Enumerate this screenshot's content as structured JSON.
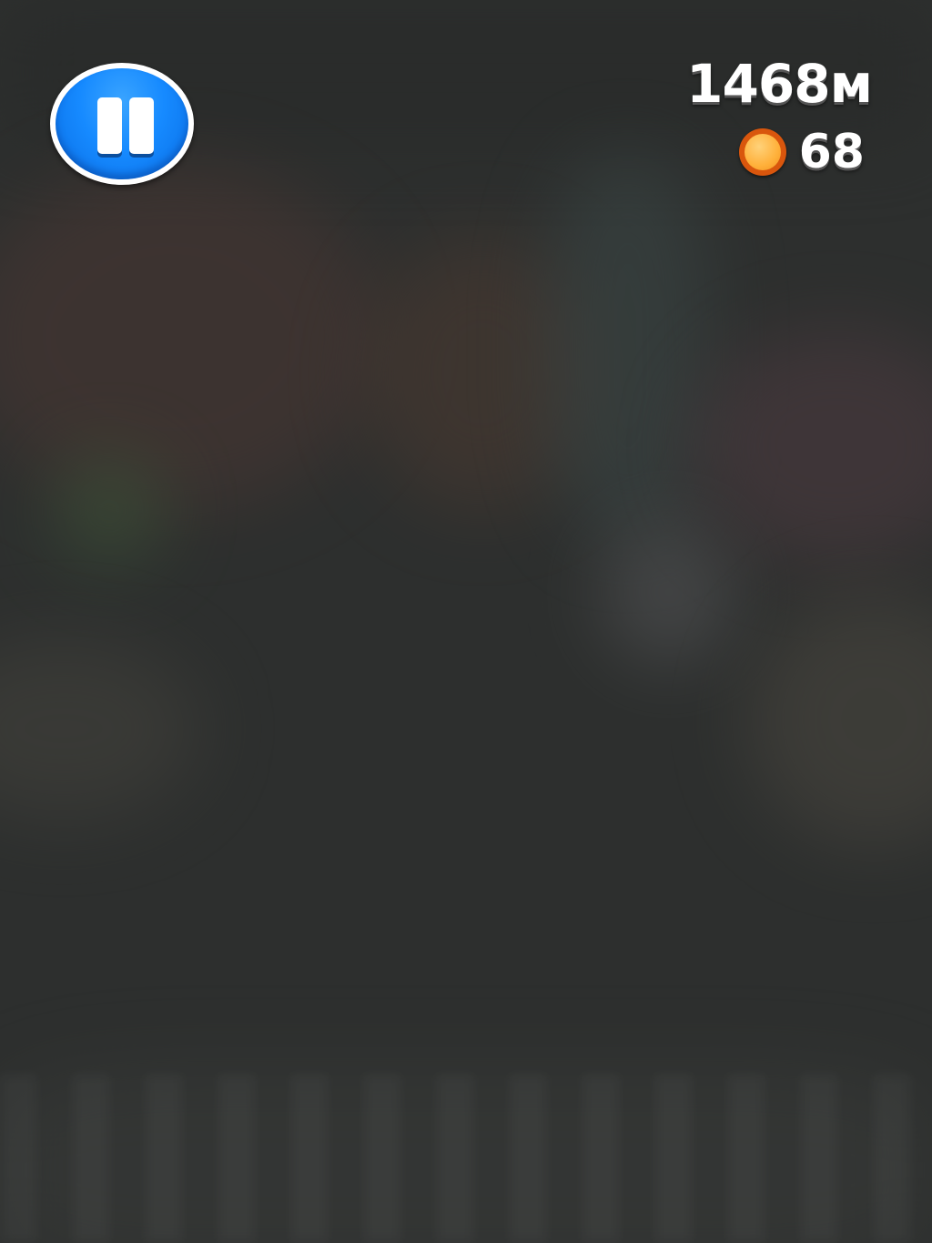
{
  "hud": {
    "distance": "1468м",
    "coins": "68"
  },
  "icons": {
    "pause": "pause-icon",
    "coin": "coin-icon"
  },
  "colors": {
    "pause_button": "#168aff",
    "coin": "#ffb03a",
    "coin_rim": "#d9560d",
    "background": "#2d2f2e"
  }
}
